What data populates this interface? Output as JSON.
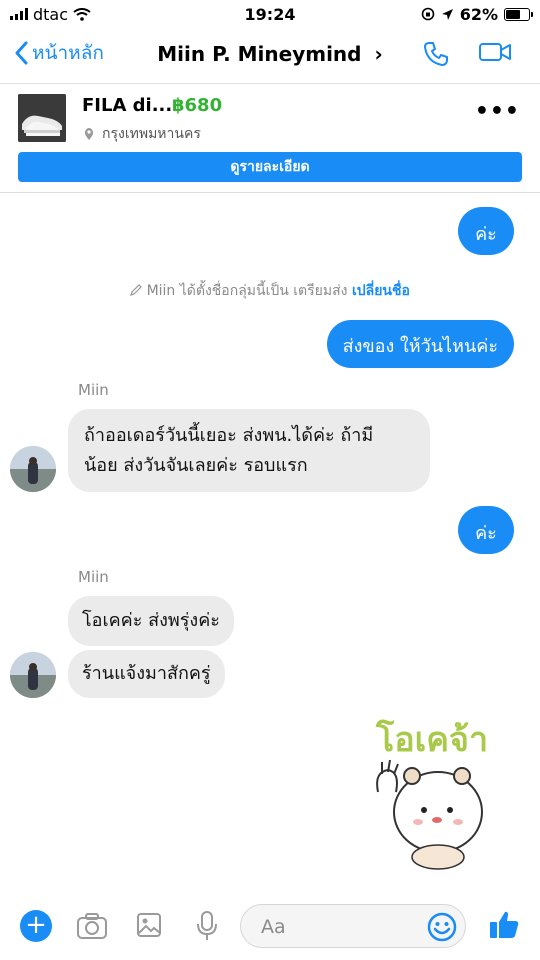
{
  "status": {
    "carrier": "dtac",
    "time": "19:24",
    "battery": "62%",
    "battery_level": 0.62
  },
  "nav": {
    "back_label": "หน้าหลัก",
    "title": "Miin P. Mineymind",
    "chevron": "›"
  },
  "product": {
    "title": "FILA di...",
    "price": "฿680",
    "location": "กรุงเทพมหานคร",
    "more": "•••",
    "details_button": "ดูรายละเอียด"
  },
  "messages": {
    "out1": "ค่ะ",
    "system_prefix": "Miin ได้ตั้งชื่อกลุ่มนี้เป็น เตรียมส่ง",
    "system_link": "เปลี่ยนชื่อ",
    "out2": "ส่งของ ให้วันไหนค่ะ",
    "sender1": "Miin",
    "in1_line1": "ถ้าออเดอร์วันนี้เยอะ ส่งพน.ได้ค่ะ ถ้ามี",
    "in1_line2": "น้อย ส่งวันจันเลยค่ะ รอบแรก",
    "out3": "ค่ะ",
    "sender2": "Miin",
    "in2": "โอเคค่ะ ส่งพรุ่งค่ะ",
    "in3": "ร้านแจ้งมาสักครู่",
    "sticker_text": "โอเคจ้า"
  },
  "input": {
    "plus": "+",
    "placeholder": "Aa"
  },
  "colors": {
    "accent": "#1a8cf5",
    "price_green": "#34b233",
    "incoming_bubble": "#ebebeb"
  },
  "icons": [
    "wifi-icon",
    "location-arrow-icon",
    "phone-icon",
    "video-icon",
    "pin-icon",
    "camera-icon",
    "image-icon",
    "mic-icon",
    "emoji-icon",
    "like-icon",
    "pencil-icon"
  ]
}
